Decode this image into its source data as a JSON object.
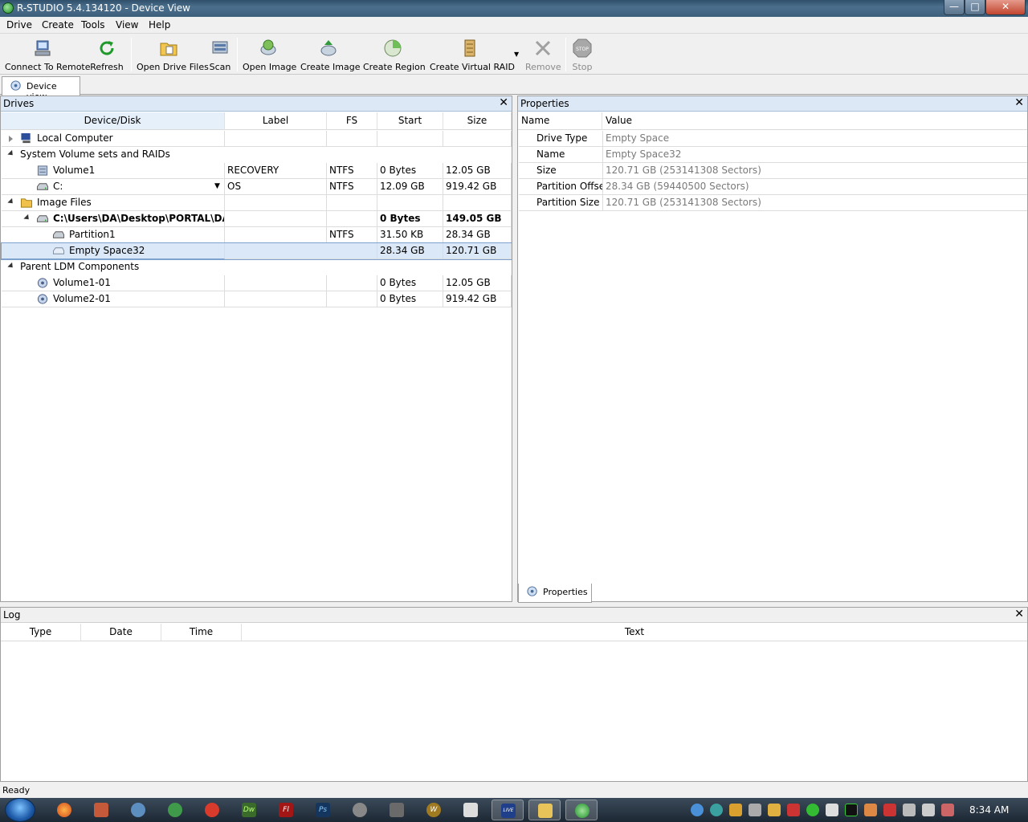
{
  "window": {
    "title": "R-STUDIO 5.4.134120 - Device View"
  },
  "menu": [
    "Drive",
    "Create",
    "Tools",
    "View",
    "Help"
  ],
  "toolbar": {
    "connect": "Connect To Remote",
    "refresh": "Refresh",
    "open_drive_files": "Open Drive Files",
    "scan": "Scan",
    "open_image": "Open Image",
    "create_image": "Create Image",
    "create_region": "Create Region",
    "create_virtual_raid": "Create Virtual RAID",
    "remove": "Remove",
    "stop": "Stop",
    "stop_glyph": "STOP"
  },
  "tabs": {
    "device_view": "Device view",
    "properties": "Properties"
  },
  "drives": {
    "title": "Drives",
    "columns": [
      "Device/Disk",
      "Label",
      "FS",
      "Start",
      "Size"
    ],
    "rows": [
      {
        "name": "Local Computer",
        "label": "",
        "fs": "",
        "start": "",
        "size": ""
      },
      {
        "name": "System Volume sets and RAIDs",
        "label": "",
        "fs": "",
        "start": "",
        "size": ""
      },
      {
        "name": "Volume1",
        "label": "RECOVERY",
        "fs": "NTFS",
        "start": "0 Bytes",
        "size": "12.05 GB"
      },
      {
        "name": "C:",
        "label": "OS",
        "fs": "NTFS",
        "start": "12.09 GB",
        "size": "919.42 GB"
      },
      {
        "name": "Image Files",
        "label": "",
        "fs": "",
        "start": "",
        "size": ""
      },
      {
        "name": "C:\\Users\\DA\\Desktop\\PORTAL\\DAT...",
        "label": "",
        "fs": "",
        "start": "0 Bytes",
        "size": "149.05 GB"
      },
      {
        "name": "Partition1",
        "label": "",
        "fs": "NTFS",
        "start": "31.50 KB",
        "size": "28.34 GB"
      },
      {
        "name": "Empty Space32",
        "label": "",
        "fs": "",
        "start": "28.34 GB",
        "size": "120.71 GB"
      },
      {
        "name": "Parent LDM Components",
        "label": "",
        "fs": "",
        "start": "",
        "size": ""
      },
      {
        "name": "Volume1-01",
        "label": "",
        "fs": "",
        "start": "0 Bytes",
        "size": "12.05 GB"
      },
      {
        "name": "Volume2-01",
        "label": "",
        "fs": "",
        "start": "0 Bytes",
        "size": "919.42 GB"
      }
    ]
  },
  "properties": {
    "title": "Properties",
    "columns": [
      "Name",
      "Value"
    ],
    "rows": [
      {
        "name": "Drive Type",
        "value": "Empty Space"
      },
      {
        "name": "Name",
        "value": "Empty Space32"
      },
      {
        "name": "Size",
        "value": "120.71 GB (253141308 Sectors)"
      },
      {
        "name": "Partition Offset",
        "value": "28.34 GB (59440500 Sectors)"
      },
      {
        "name": "Partition Size",
        "value": "120.71 GB (253141308 Sectors)"
      }
    ]
  },
  "log": {
    "title": "Log",
    "columns": [
      "Type",
      "Date",
      "Time",
      "Text"
    ]
  },
  "status": "Ready",
  "taskbar": {
    "clock": "8:34 AM",
    "dw": "Dw",
    "fl": "Fl",
    "ps": "Ps",
    "w": "W",
    "live": "LIVE"
  },
  "colors": {
    "selection": "#dbe8f7",
    "header": "#dce8f5",
    "titlebar": "#3c5f7c"
  }
}
